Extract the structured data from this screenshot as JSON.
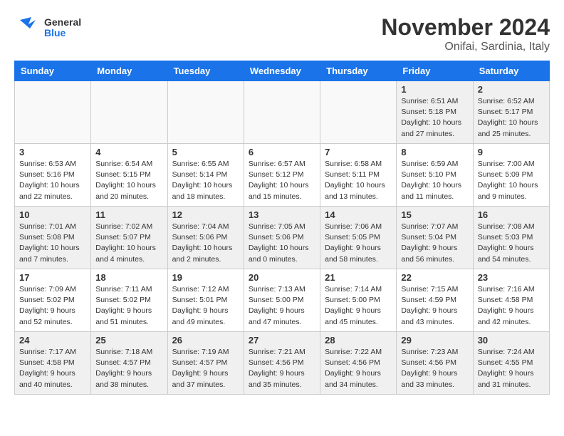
{
  "logo": {
    "line1": "General",
    "line2": "Blue"
  },
  "title": "November 2024",
  "location": "Onifai, Sardinia, Italy",
  "weekdays": [
    "Sunday",
    "Monday",
    "Tuesday",
    "Wednesday",
    "Thursday",
    "Friday",
    "Saturday"
  ],
  "weeks": [
    [
      {
        "day": "",
        "info": ""
      },
      {
        "day": "",
        "info": ""
      },
      {
        "day": "",
        "info": ""
      },
      {
        "day": "",
        "info": ""
      },
      {
        "day": "",
        "info": ""
      },
      {
        "day": "1",
        "info": "Sunrise: 6:51 AM\nSunset: 5:18 PM\nDaylight: 10 hours\nand 27 minutes."
      },
      {
        "day": "2",
        "info": "Sunrise: 6:52 AM\nSunset: 5:17 PM\nDaylight: 10 hours\nand 25 minutes."
      }
    ],
    [
      {
        "day": "3",
        "info": "Sunrise: 6:53 AM\nSunset: 5:16 PM\nDaylight: 10 hours\nand 22 minutes."
      },
      {
        "day": "4",
        "info": "Sunrise: 6:54 AM\nSunset: 5:15 PM\nDaylight: 10 hours\nand 20 minutes."
      },
      {
        "day": "5",
        "info": "Sunrise: 6:55 AM\nSunset: 5:14 PM\nDaylight: 10 hours\nand 18 minutes."
      },
      {
        "day": "6",
        "info": "Sunrise: 6:57 AM\nSunset: 5:12 PM\nDaylight: 10 hours\nand 15 minutes."
      },
      {
        "day": "7",
        "info": "Sunrise: 6:58 AM\nSunset: 5:11 PM\nDaylight: 10 hours\nand 13 minutes."
      },
      {
        "day": "8",
        "info": "Sunrise: 6:59 AM\nSunset: 5:10 PM\nDaylight: 10 hours\nand 11 minutes."
      },
      {
        "day": "9",
        "info": "Sunrise: 7:00 AM\nSunset: 5:09 PM\nDaylight: 10 hours\nand 9 minutes."
      }
    ],
    [
      {
        "day": "10",
        "info": "Sunrise: 7:01 AM\nSunset: 5:08 PM\nDaylight: 10 hours\nand 7 minutes."
      },
      {
        "day": "11",
        "info": "Sunrise: 7:02 AM\nSunset: 5:07 PM\nDaylight: 10 hours\nand 4 minutes."
      },
      {
        "day": "12",
        "info": "Sunrise: 7:04 AM\nSunset: 5:06 PM\nDaylight: 10 hours\nand 2 minutes."
      },
      {
        "day": "13",
        "info": "Sunrise: 7:05 AM\nSunset: 5:06 PM\nDaylight: 10 hours\nand 0 minutes."
      },
      {
        "day": "14",
        "info": "Sunrise: 7:06 AM\nSunset: 5:05 PM\nDaylight: 9 hours\nand 58 minutes."
      },
      {
        "day": "15",
        "info": "Sunrise: 7:07 AM\nSunset: 5:04 PM\nDaylight: 9 hours\nand 56 minutes."
      },
      {
        "day": "16",
        "info": "Sunrise: 7:08 AM\nSunset: 5:03 PM\nDaylight: 9 hours\nand 54 minutes."
      }
    ],
    [
      {
        "day": "17",
        "info": "Sunrise: 7:09 AM\nSunset: 5:02 PM\nDaylight: 9 hours\nand 52 minutes."
      },
      {
        "day": "18",
        "info": "Sunrise: 7:11 AM\nSunset: 5:02 PM\nDaylight: 9 hours\nand 51 minutes."
      },
      {
        "day": "19",
        "info": "Sunrise: 7:12 AM\nSunset: 5:01 PM\nDaylight: 9 hours\nand 49 minutes."
      },
      {
        "day": "20",
        "info": "Sunrise: 7:13 AM\nSunset: 5:00 PM\nDaylight: 9 hours\nand 47 minutes."
      },
      {
        "day": "21",
        "info": "Sunrise: 7:14 AM\nSunset: 5:00 PM\nDaylight: 9 hours\nand 45 minutes."
      },
      {
        "day": "22",
        "info": "Sunrise: 7:15 AM\nSunset: 4:59 PM\nDaylight: 9 hours\nand 43 minutes."
      },
      {
        "day": "23",
        "info": "Sunrise: 7:16 AM\nSunset: 4:58 PM\nDaylight: 9 hours\nand 42 minutes."
      }
    ],
    [
      {
        "day": "24",
        "info": "Sunrise: 7:17 AM\nSunset: 4:58 PM\nDaylight: 9 hours\nand 40 minutes."
      },
      {
        "day": "25",
        "info": "Sunrise: 7:18 AM\nSunset: 4:57 PM\nDaylight: 9 hours\nand 38 minutes."
      },
      {
        "day": "26",
        "info": "Sunrise: 7:19 AM\nSunset: 4:57 PM\nDaylight: 9 hours\nand 37 minutes."
      },
      {
        "day": "27",
        "info": "Sunrise: 7:21 AM\nSunset: 4:56 PM\nDaylight: 9 hours\nand 35 minutes."
      },
      {
        "day": "28",
        "info": "Sunrise: 7:22 AM\nSunset: 4:56 PM\nDaylight: 9 hours\nand 34 minutes."
      },
      {
        "day": "29",
        "info": "Sunrise: 7:23 AM\nSunset: 4:56 PM\nDaylight: 9 hours\nand 33 minutes."
      },
      {
        "day": "30",
        "info": "Sunrise: 7:24 AM\nSunset: 4:55 PM\nDaylight: 9 hours\nand 31 minutes."
      }
    ]
  ],
  "colors": {
    "header_bg": "#1a73e8",
    "shaded_row": "#f0f0f0"
  }
}
